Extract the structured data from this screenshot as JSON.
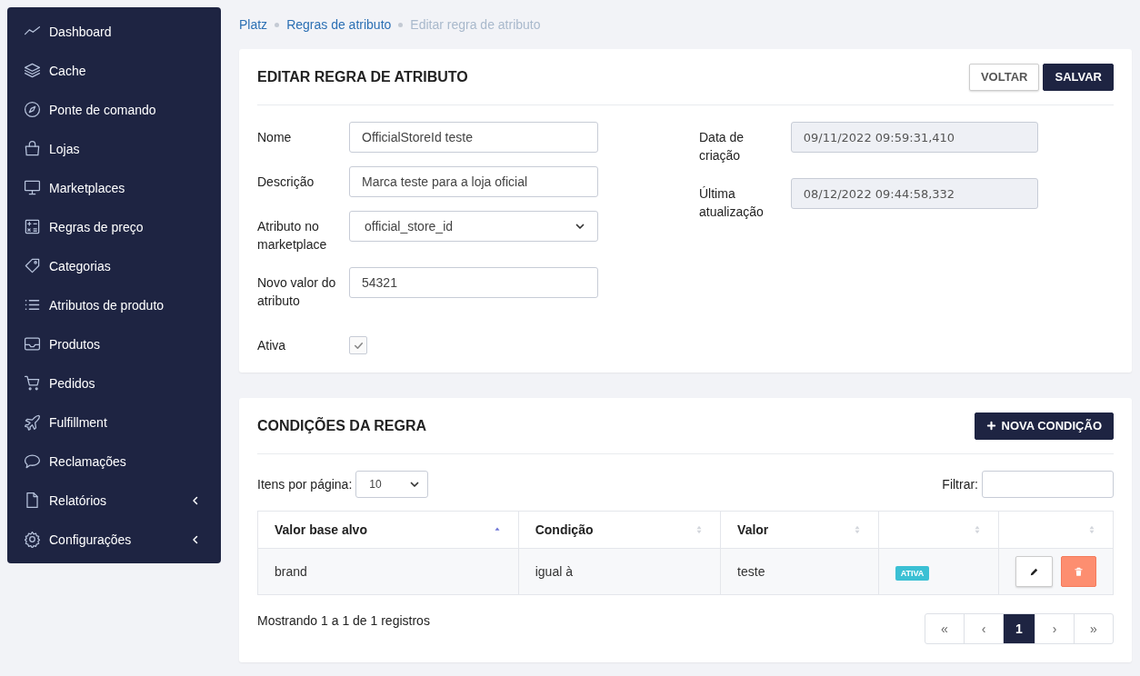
{
  "sidebar": {
    "items": [
      {
        "label": "Dashboard",
        "has_submenu": false
      },
      {
        "label": "Cache",
        "has_submenu": false
      },
      {
        "label": "Ponte de comando",
        "has_submenu": false
      },
      {
        "label": "Lojas",
        "has_submenu": false
      },
      {
        "label": "Marketplaces",
        "has_submenu": false
      },
      {
        "label": "Regras de preço",
        "has_submenu": false
      },
      {
        "label": "Categorias",
        "has_submenu": false
      },
      {
        "label": "Atributos de produto",
        "has_submenu": false
      },
      {
        "label": "Produtos",
        "has_submenu": false
      },
      {
        "label": "Pedidos",
        "has_submenu": false
      },
      {
        "label": "Fulfillment",
        "has_submenu": false
      },
      {
        "label": "Reclamações",
        "has_submenu": false
      },
      {
        "label": "Relatórios",
        "has_submenu": true
      },
      {
        "label": "Configurações",
        "has_submenu": true
      }
    ]
  },
  "breadcrumb": [
    {
      "label": "Platz",
      "current": false
    },
    {
      "label": "Regras de atributo",
      "current": false
    },
    {
      "label": "Editar regra de atributo",
      "current": true
    }
  ],
  "edit_card": {
    "title": "EDITAR REGRA DE ATRIBUTO",
    "buttons": [
      {
        "label": "VOLTAR",
        "kind": "secondary"
      },
      {
        "label": "SALVAR",
        "kind": "primary"
      }
    ],
    "left_fields": [
      {
        "label": "Nome",
        "kind": "text",
        "value": "OfficialStoreId teste"
      },
      {
        "label": "Descrição",
        "kind": "text",
        "value": "Marca teste para a loja oficial"
      },
      {
        "label": "Atributo no marketplace",
        "kind": "select",
        "value": "official_store_id"
      },
      {
        "label": "Novo valor do atributo",
        "kind": "text",
        "value": "54321"
      },
      {
        "label": "Ativa",
        "kind": "checkbox",
        "checked": true
      }
    ],
    "right_fields": [
      {
        "label": "Data de criação",
        "kind": "readonly",
        "value": "09/11/2022 09:59:31,410"
      },
      {
        "label": "Última atualização",
        "kind": "readonly",
        "value": "08/12/2022 09:44:58,332"
      }
    ]
  },
  "conditions_card": {
    "title": "CONDIÇÕES DA REGRA",
    "new_button": "NOVA CONDIÇÃO",
    "page_size_label": "Itens por página:",
    "page_size": "10",
    "filter_label": "Filtrar:",
    "table": {
      "columns": [
        {
          "label": "Valor base alvo",
          "sorted": true
        },
        {
          "label": "Condição",
          "sorted": false
        },
        {
          "label": "Valor",
          "sorted": false
        },
        {
          "sorted": false
        },
        {
          "sorted": false
        }
      ],
      "rows": [
        {
          "cells": [
            "brand",
            "igual à",
            "teste"
          ],
          "status": "ATIVA"
        }
      ]
    },
    "summary": "Mostrando 1 a 1 de 1 registros",
    "pagination": [
      {
        "label": "«",
        "selected": false
      },
      {
        "label": "‹",
        "selected": false
      },
      {
        "label": "1",
        "selected": true
      },
      {
        "label": "›",
        "selected": false
      },
      {
        "label": "»",
        "selected": false
      }
    ]
  }
}
